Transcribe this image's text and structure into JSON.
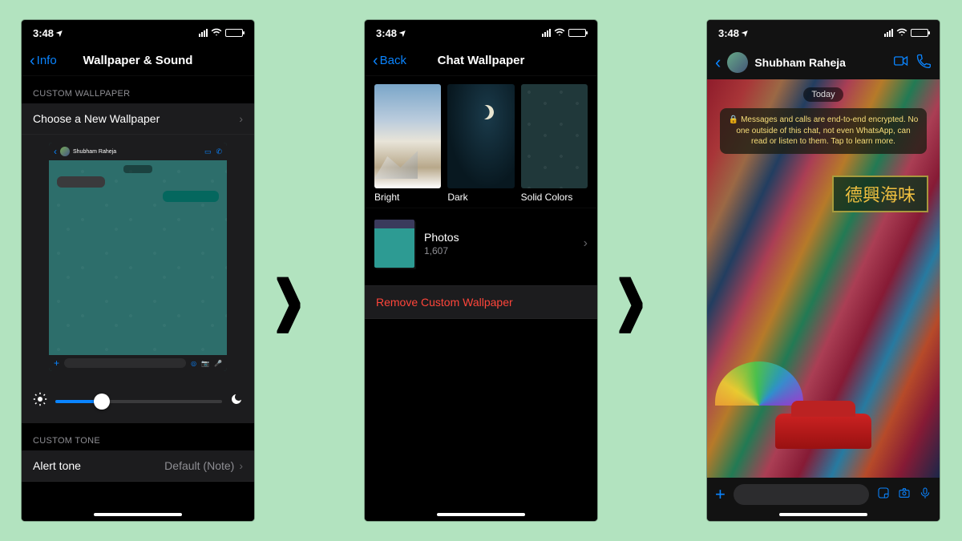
{
  "status": {
    "time": "3:48",
    "loc_glyph": "➤"
  },
  "screen1": {
    "back_label": "Info",
    "title": "Wallpaper & Sound",
    "section_wallpaper": "CUSTOM WALLPAPER",
    "choose_row": "Choose a New Wallpaper",
    "preview_name": "Shubham Raheja",
    "section_tone": "CUSTOM TONE",
    "alert_row": "Alert tone",
    "alert_detail": "Default (Note)"
  },
  "screen2": {
    "back_label": "Back",
    "title": "Chat Wallpaper",
    "tile_bright": "Bright",
    "tile_dark": "Dark",
    "tile_solid": "Solid Colors",
    "photos_label": "Photos",
    "photos_count": "1,607",
    "remove_label": "Remove Custom Wallpaper"
  },
  "screen3": {
    "contact_name": "Shubham Raheja",
    "day_label": "Today",
    "encryption_notice": "Messages and calls are end-to-end encrypted. No one outside of this chat, not even WhatsApp, can read or listen to them. Tap to learn more.",
    "signboard": "德興海味"
  }
}
